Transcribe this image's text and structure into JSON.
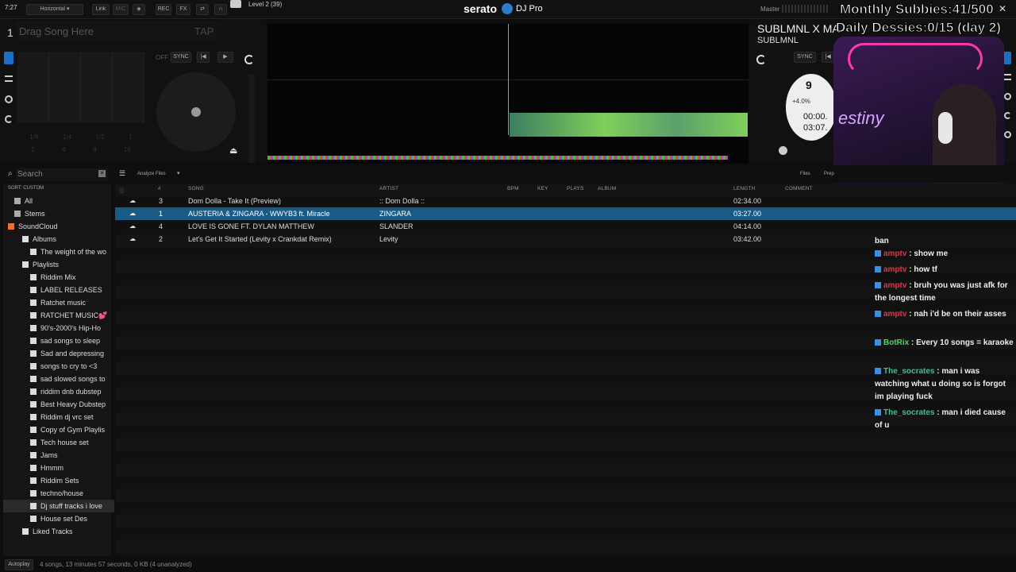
{
  "topbar": {
    "time": "7:27",
    "layout_label": "Horizontal",
    "link_label": "Link",
    "mic_label": "MIC",
    "rec_label": "REC",
    "fx_label": "FX",
    "deck_info": "Level 2  (39)",
    "brand": "serato",
    "brand_suffix": "DJ Pro",
    "master_label": "Master"
  },
  "overlay": {
    "subs": "Monthly Subbies:41/500",
    "dessies": "Daily Dessies:0/15 (day 2)",
    "webcam_name": "estiny"
  },
  "deck_left": {
    "number": "1",
    "drag_text": "Drag Song Here",
    "tap_label": "TAP",
    "sync_label": "SYNC",
    "off_label": "OFF",
    "pad_values": [
      "1/8",
      "1/4",
      "1/2",
      "1",
      "2",
      "4",
      "8",
      "16"
    ]
  },
  "deck_right": {
    "title": "SUBLMNL X  MA",
    "artist": "SUBLMNL",
    "sync_label": "SYNC",
    "bpm_partial": "9",
    "pitch": "+4.0%",
    "elapsed": "00:00.",
    "remaining": "03:07."
  },
  "library": {
    "search_placeholder": "Search",
    "sort_label": "SORT: CUSTOM",
    "analyze_label": "Analyze Files",
    "files_label": "Files",
    "prep_label": "Prep",
    "columns": {
      "num": "#",
      "song": "SONG",
      "artist": "ARTIST",
      "bpm": "BPM",
      "key": "KEY",
      "plays": "PLAYS",
      "album": "ALBUM",
      "length": "LENGTH",
      "comment": "COMMENT"
    },
    "tracks": [
      {
        "num": "3",
        "song": "Dom Dolla - Take It (Preview)",
        "artist": ":: Dom Dolla ::",
        "length": "02:34.00"
      },
      {
        "num": "1",
        "song": "AUSTERIA & ZINGARA - WWYB3 ft. Miracle",
        "artist": "ZINGARA",
        "length": "03:27.00"
      },
      {
        "num": "4",
        "song": "LOVE IS GONE FT. DYLAN MATTHEW",
        "artist": "SLANDER",
        "length": "04:14.00"
      },
      {
        "num": "2",
        "song": "Let's Get It Started (Levity x Crankdat Remix)",
        "artist": "Levity",
        "length": "03:42.00"
      }
    ],
    "status": "4 songs, 13 minutes 57 seconds, 0 KB (4 unanalyzed)",
    "autoplay": "Autoplay"
  },
  "sidebar": {
    "top": [
      "All",
      "Stems",
      "SoundCloud",
      "Albums",
      "The weight of the wo",
      "Playlists"
    ],
    "playlists": [
      "Riddim Mix",
      "LABEL RELEASES",
      "Ratchet music",
      "RATCHET MUSIC💕",
      "90's-2000's Hip-Ho",
      "sad songs to sleep",
      "Sad and depressing",
      "songs to cry to <3",
      "sad slowed songs to",
      "riddim dnb dubstep",
      "Best Heavy Dubstep",
      "Riddim dj vrc set",
      "Copy of Gym Playlis",
      "Tech house set",
      "Jams",
      "Hmmm",
      "Riddim Sets",
      "techno/house",
      "Dj stuff tracks i love",
      "House set Des"
    ],
    "liked": "Liked Tracks"
  },
  "chat": [
    {
      "user": "",
      "text": "ban",
      "color": "#eeeeee"
    },
    {
      "user": "amptv",
      "text": ": show me",
      "color": "#e0344a"
    },
    {
      "user": "amptv",
      "text": ": how tf",
      "color": "#e0344a"
    },
    {
      "user": "amptv",
      "text": ": bruh you was just afk for the longest time",
      "color": "#e0344a"
    },
    {
      "user": "amptv",
      "text": ": nah i'd be on their asses",
      "color": "#e0344a"
    },
    {
      "user": "BotRix",
      "text": ": Every 10 songs = karaoke",
      "color": "#52d867"
    },
    {
      "user": "The_socrates",
      "text": ": man i was watching what u doing so is forgot im playing fuck",
      "color": "#39c58e"
    },
    {
      "user": "The_socrates",
      "text": ": man i died cause of u",
      "color": "#39c58e"
    }
  ]
}
